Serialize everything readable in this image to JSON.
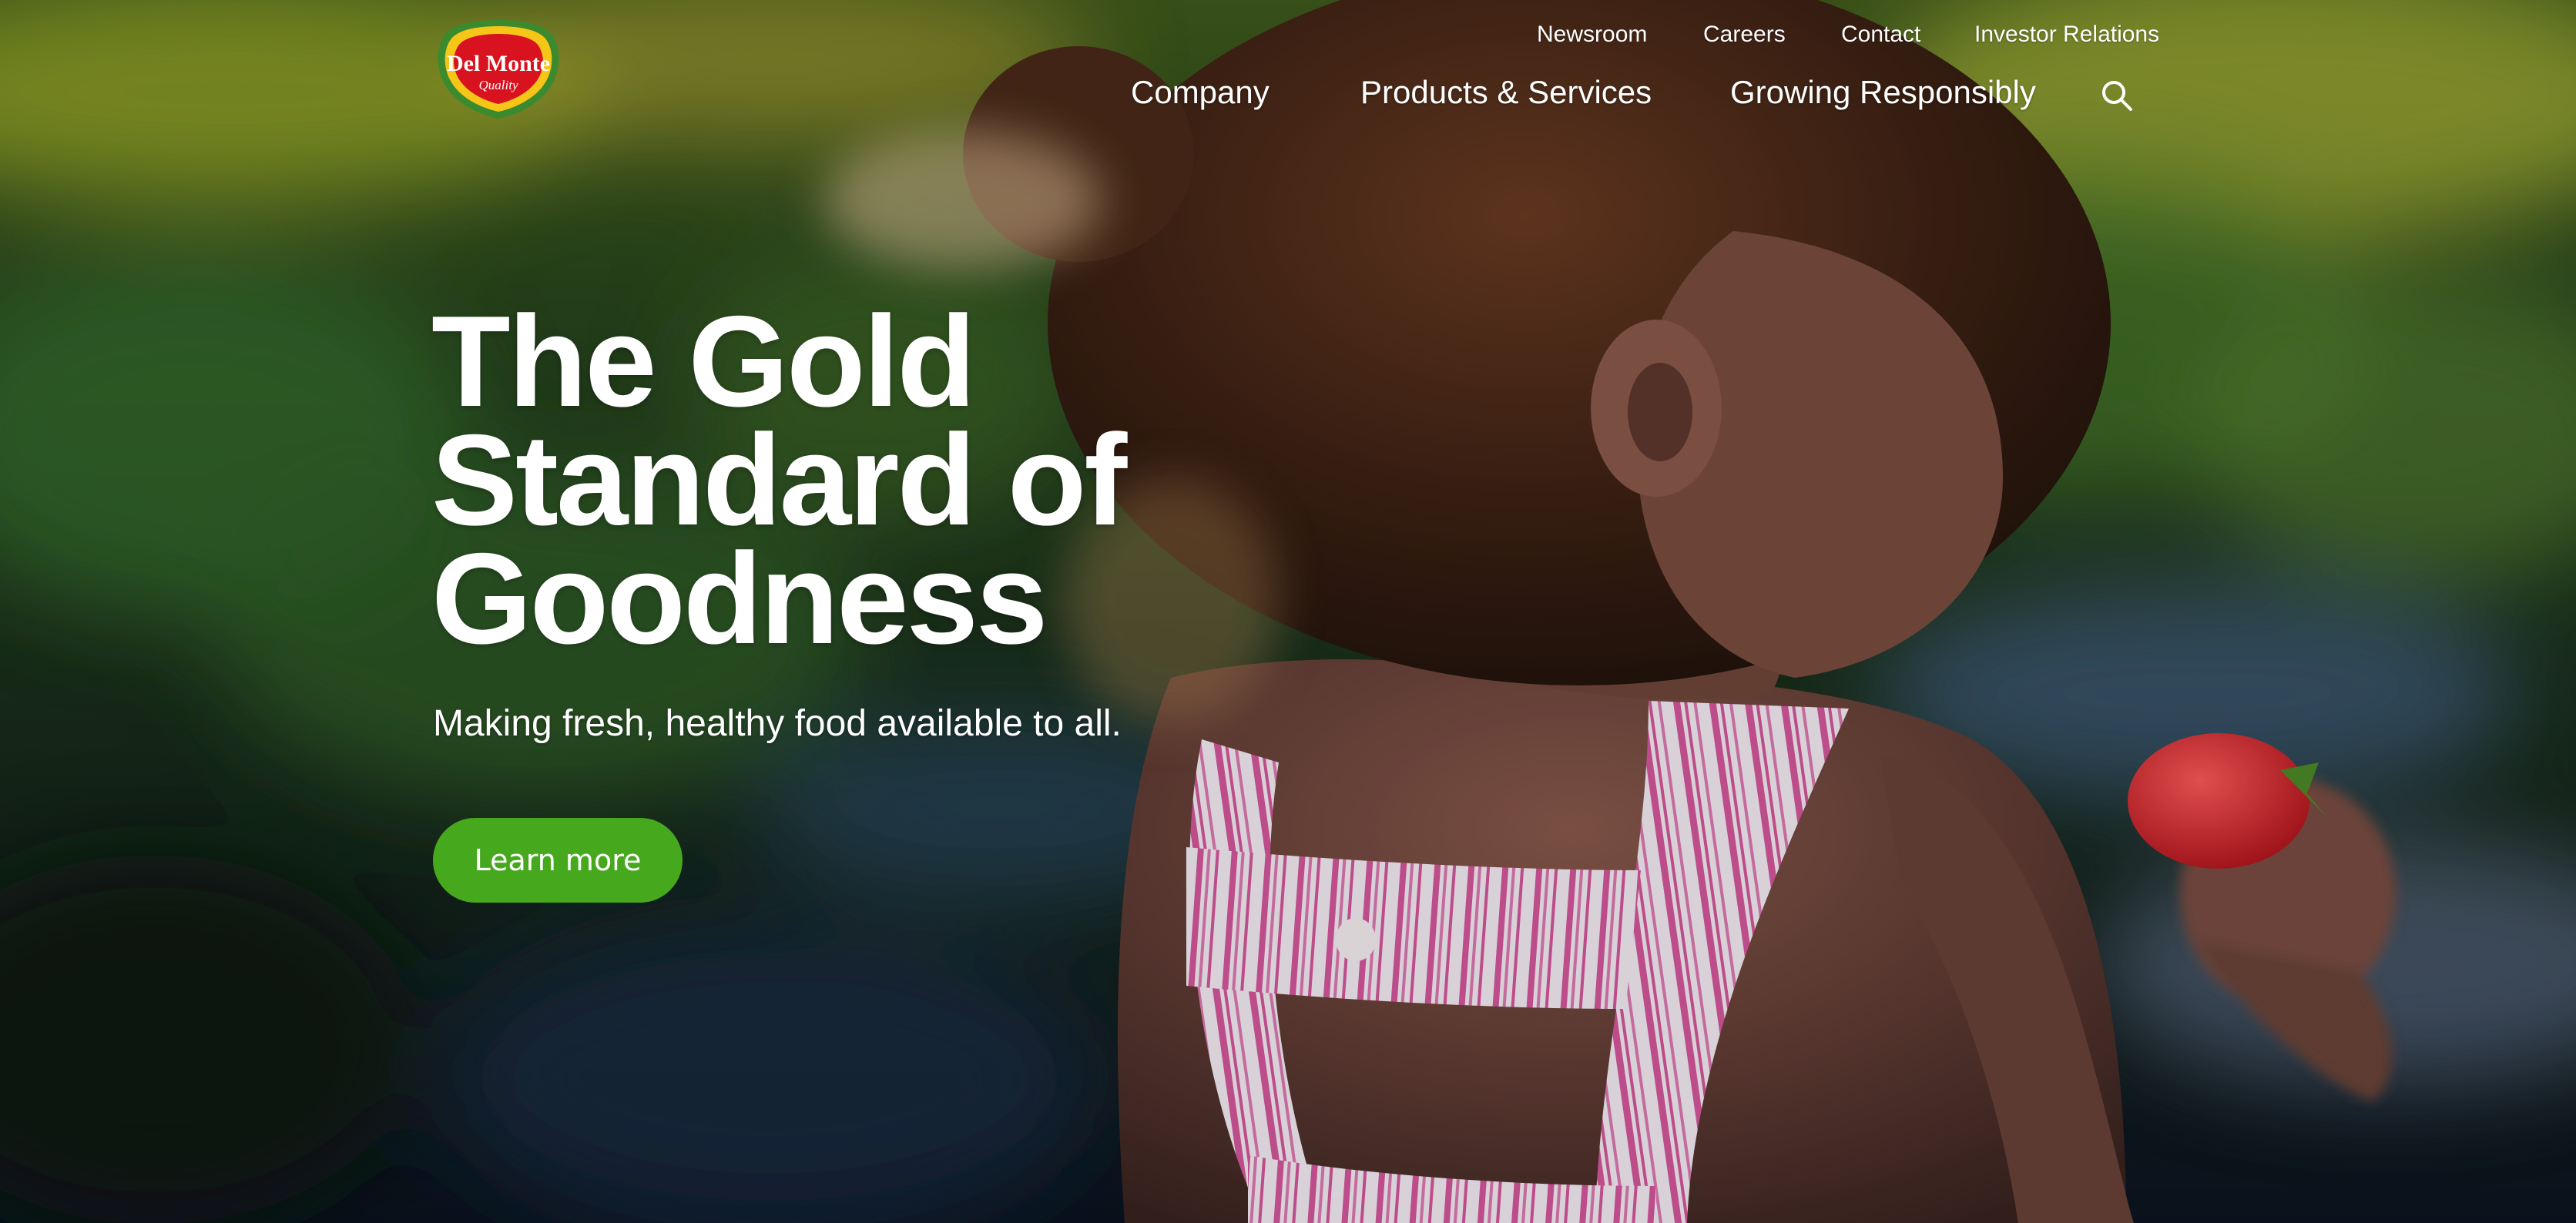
{
  "brand": {
    "logo_text": "Del Monte",
    "logo_subtext": "Quality",
    "colors": {
      "logo_red": "#d8121f",
      "logo_gold": "#f5c518",
      "logo_green": "#3c8a2e",
      "cta_green": "#46a91d"
    }
  },
  "utility_nav": {
    "items": [
      {
        "label": "Newsroom"
      },
      {
        "label": "Careers"
      },
      {
        "label": "Contact"
      },
      {
        "label": "Investor Relations"
      }
    ]
  },
  "main_nav": {
    "items": [
      {
        "label": "Company"
      },
      {
        "label": "Products & Services"
      },
      {
        "label": "Growing Responsibly"
      }
    ],
    "search_icon": "search-icon"
  },
  "hero": {
    "headline_lines": [
      "The Gold",
      "Standard of",
      "Goodness"
    ],
    "subheadline": "Making fresh, healthy food available to all.",
    "cta_label": "Learn more"
  }
}
